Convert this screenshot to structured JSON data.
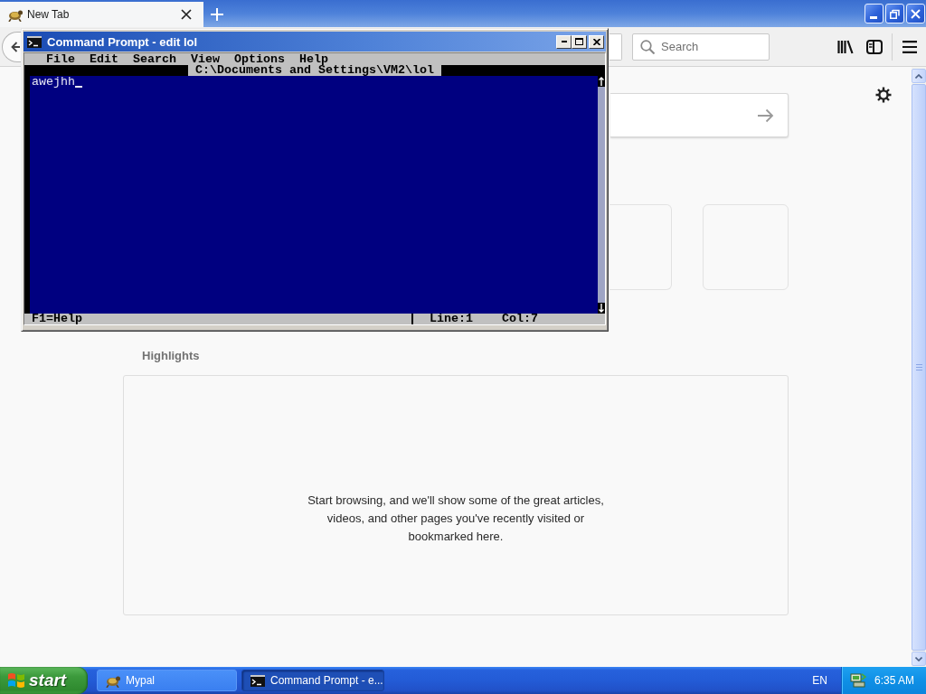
{
  "browser": {
    "tabs": [
      {
        "label": "New Tab",
        "selected": true
      }
    ],
    "search": {
      "placeholder": "Search"
    },
    "highlights": {
      "title": "Highlights",
      "message": "Start browsing, and we'll show some of the great articles, videos, and other pages you've recently visited or bookmarked here."
    }
  },
  "console": {
    "title": "Command Prompt - edit lol",
    "menu": [
      "File",
      "Edit",
      "Search",
      "View",
      "Options",
      "Help"
    ],
    "file_path": "C:\\Documents and Settings\\VM2\\lol",
    "text": "awejhh",
    "status": {
      "hint": "F1=Help",
      "line": "Line:1",
      "column": "Col:7"
    }
  },
  "taskbar": {
    "start": "start",
    "tasks": [
      {
        "kind": "browser",
        "label": "Mypal",
        "selected": false
      },
      {
        "kind": "console",
        "label": "Command Prompt - e...",
        "selected": true
      }
    ],
    "language": "EN",
    "clock": "6:35 AM"
  }
}
